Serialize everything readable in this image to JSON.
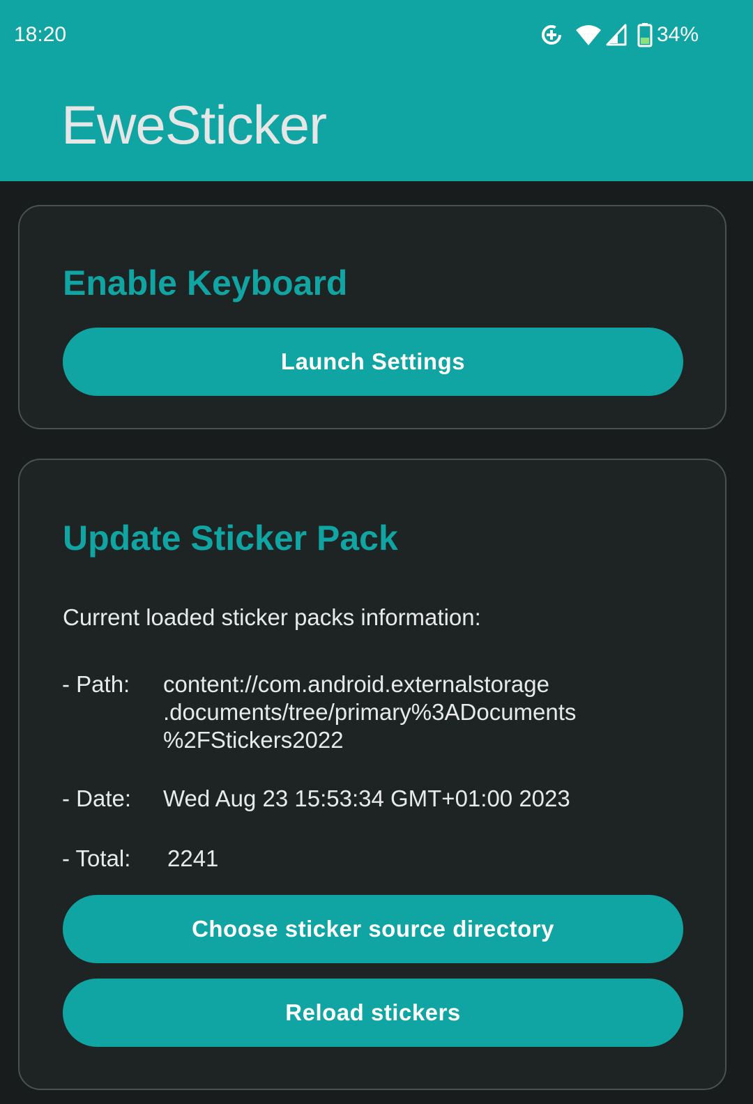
{
  "status_bar": {
    "time": "18:20",
    "battery": "34%",
    "icons": [
      "data-saver-icon",
      "wifi-icon",
      "cell-signal-icon",
      "battery-icon"
    ]
  },
  "app": {
    "title": "EweSticker"
  },
  "enable_keyboard": {
    "title": "Enable Keyboard",
    "button": "Launch Settings"
  },
  "update_pack": {
    "title": "Update Sticker Pack",
    "intro": "Current loaded sticker packs information:",
    "path_label": "- Path:",
    "path_lines": [
      "content://com.android.externalstorage",
      ".documents/tree/primary%3ADocuments",
      "%2FStickers2022"
    ],
    "date_label": "- Date:",
    "date_value": "Wed Aug 23 15:53:34 GMT+01:00 2023",
    "total_label": "- Total:",
    "total_value": "2241",
    "choose_button": "Choose sticker source directory",
    "reload_button": "Reload stickers"
  },
  "colors": {
    "accent": "#10a5a3",
    "background": "#191c1c",
    "card": "#1e2424",
    "card_border": "#4b5151",
    "text": "#e8eaea"
  }
}
